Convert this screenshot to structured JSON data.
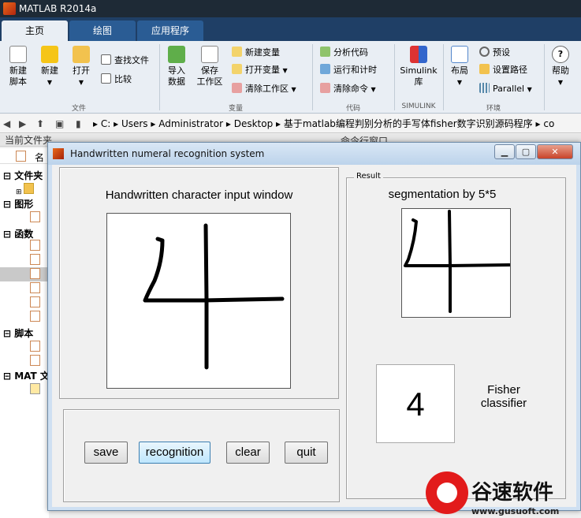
{
  "app": {
    "title": "MATLAB R2014a"
  },
  "ribbon": {
    "tabs": [
      "主页",
      "绘图",
      "应用程序"
    ],
    "buttons": {
      "new_script": "新建\n脚本",
      "new": "新建",
      "open": "打开",
      "find_files": "查找文件",
      "compare": "比较",
      "import_data": "导入\n数据",
      "save_workspace": "保存\n工作区",
      "new_variable": "新建变量",
      "open_variable": "打开变量",
      "clear_workspace": "清除工作区",
      "analyze_code": "分析代码",
      "run_and_time": "运行和计时",
      "clear_commands": "清除命令",
      "simulink_library": "Simulink\n库",
      "layout": "布局",
      "preferences": "预设",
      "set_path": "设置路径",
      "parallel": "Parallel",
      "help": "帮助"
    },
    "groups": {
      "file": "文件",
      "variable": "变量",
      "code": "代码",
      "simulink": "SIMULINK",
      "environment": "环境"
    }
  },
  "address": {
    "segments": [
      "C:",
      "Users",
      "Administrator",
      "Desktop",
      "基于matlab编程判别分析的手写体fisher数字识别源码程序",
      "co"
    ]
  },
  "current_folder": {
    "title": "当前文件夹",
    "name_col": "名",
    "sections": [
      "文件夹",
      "图形",
      "函数",
      "脚本",
      "MAT 文"
    ]
  },
  "command_window": {
    "title": "命令行窗口"
  },
  "figure": {
    "title": "Handwritten numeral recognition system",
    "input_title": "Handwritten character input window",
    "result_legend": "Result",
    "segmentation_title": "segmentation by 5*5",
    "buttons": {
      "save": "save",
      "recognition": "recognition",
      "clear": "clear",
      "quit": "quit"
    },
    "recognized_digit": "4",
    "classifier_label": "Fisher\nclassifier"
  },
  "watermark": {
    "text": "谷速软件",
    "url": "www.gusuoft.com"
  }
}
